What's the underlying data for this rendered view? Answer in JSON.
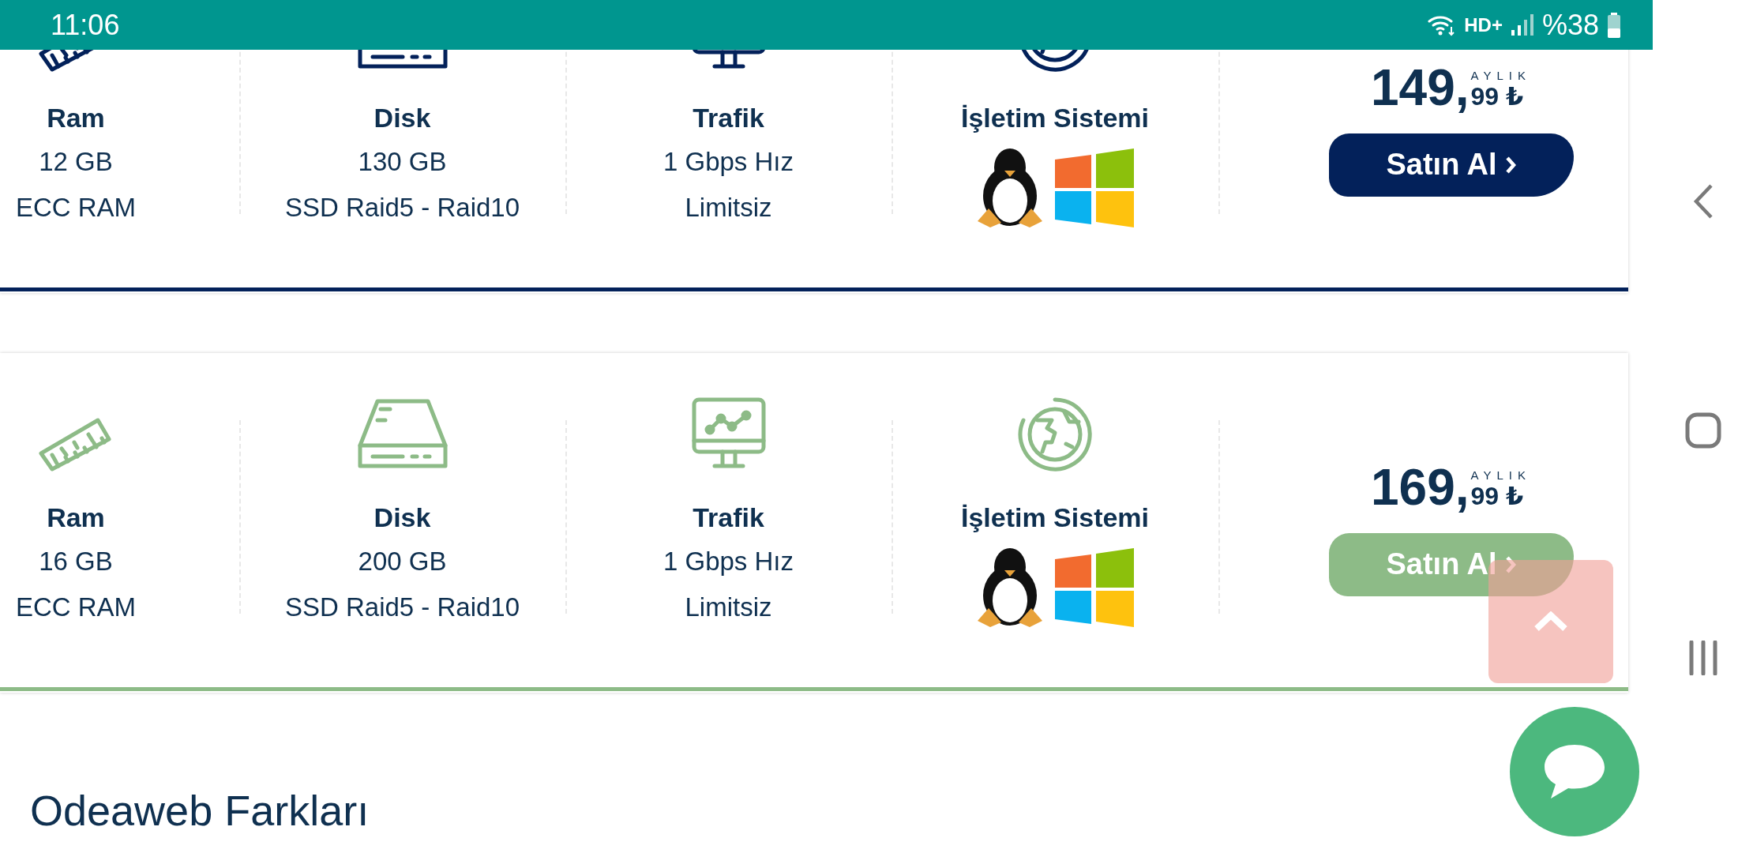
{
  "status_bar": {
    "time": "11:06",
    "network": "HD+",
    "battery": "%38"
  },
  "plans": [
    {
      "color": "#03215a",
      "specs": [
        {
          "kind": "ram",
          "title": "Ram",
          "lines": [
            "12 GB",
            "ECC RAM"
          ]
        },
        {
          "kind": "disk",
          "title": "Disk",
          "lines": [
            "130 GB",
            "SSD Raid5 - Raid10"
          ]
        },
        {
          "kind": "traffic",
          "title": "Trafik",
          "lines": [
            "1 Gbps Hız",
            "Limitsiz"
          ]
        },
        {
          "kind": "os",
          "title": "İşletim Sistemi"
        }
      ],
      "price": {
        "whole": "149,",
        "fraction": "99 ₺",
        "period": "AYLIK"
      },
      "button": "Satın Al"
    },
    {
      "color": "#8dbb87",
      "specs": [
        {
          "kind": "ram",
          "title": "Ram",
          "lines": [
            "16 GB",
            "ECC RAM"
          ]
        },
        {
          "kind": "disk",
          "title": "Disk",
          "lines": [
            "200 GB",
            "SSD Raid5 - Raid10"
          ]
        },
        {
          "kind": "traffic",
          "title": "Trafik",
          "lines": [
            "1 Gbps Hız",
            "Limitsiz"
          ]
        },
        {
          "kind": "os",
          "title": "İşletim Sistemi"
        }
      ],
      "price": {
        "whole": "169,",
        "fraction": "99 ₺",
        "period": "AYLIK"
      },
      "button": "Satın Al"
    }
  ],
  "heading": "Odeaweb Farkları"
}
